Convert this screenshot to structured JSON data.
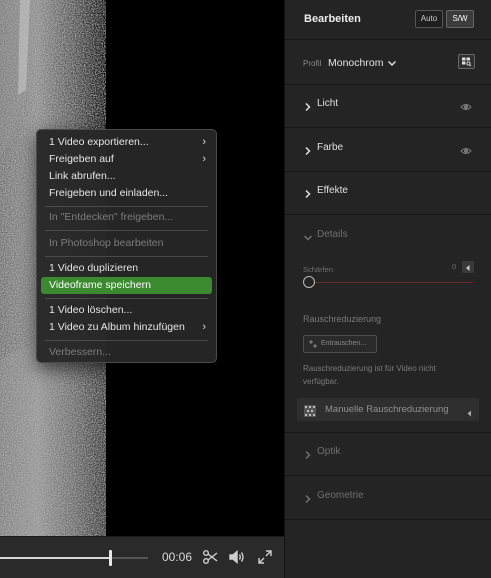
{
  "player": {
    "time": "00:06",
    "progress": 0.74
  },
  "context_menu": {
    "items": [
      {
        "label": "1 Video exportieren...",
        "submenu": true,
        "disabled": false,
        "active": false
      },
      {
        "label": "Freigeben auf",
        "submenu": true,
        "disabled": false,
        "active": false
      },
      {
        "label": "Link abrufen...",
        "submenu": false,
        "disabled": false,
        "active": false
      },
      {
        "label": "Freigeben und einladen...",
        "submenu": false,
        "disabled": false,
        "active": false
      },
      {
        "label": "In \"Entdecken\" freigeben...",
        "submenu": false,
        "disabled": true,
        "active": false
      },
      {
        "label": "In Photoshop bearbeiten",
        "submenu": false,
        "disabled": true,
        "active": false
      },
      {
        "label": "1 Video duplizieren",
        "submenu": false,
        "disabled": false,
        "active": false
      },
      {
        "label": "Videoframe speichern",
        "submenu": false,
        "disabled": false,
        "active": true
      },
      {
        "label": "1 Video löschen...",
        "submenu": false,
        "disabled": false,
        "active": false
      },
      {
        "label": "1 Video zu Album hinzufügen",
        "submenu": true,
        "disabled": false,
        "active": false
      },
      {
        "label": "Verbessern...",
        "submenu": false,
        "disabled": true,
        "active": false
      }
    ],
    "highlight_color": "#3b8a2f"
  },
  "panel": {
    "title": "Bearbeiten",
    "auto_label": "Auto",
    "sw_label": "S/W",
    "profile_label": "Profil",
    "profile_value": "Monochrom",
    "sections": {
      "licht": "Licht",
      "farbe": "Farbe",
      "effekte": "Effekte",
      "details": "Details",
      "optik": "Optik",
      "geometrie": "Geometrie"
    },
    "sharpen_label": "Schärfen",
    "sharpen_value": "0",
    "noise_heading": "Rauschreduzierung",
    "enhance_label": "Entrauschen...",
    "noise_note": "Rauschreduzierung ist für Video nicht verfügbar.",
    "manual_noise_label": "Manuelle Rauschreduzierung"
  },
  "icons": {
    "chevron_right": "chevron-right-icon",
    "chevron_down": "chevron-down-icon",
    "eye": "eye-icon",
    "profile_browser": "grid-icon",
    "trim": "scissors-icon",
    "volume": "speaker-icon",
    "fullscreen": "expand-icon"
  }
}
